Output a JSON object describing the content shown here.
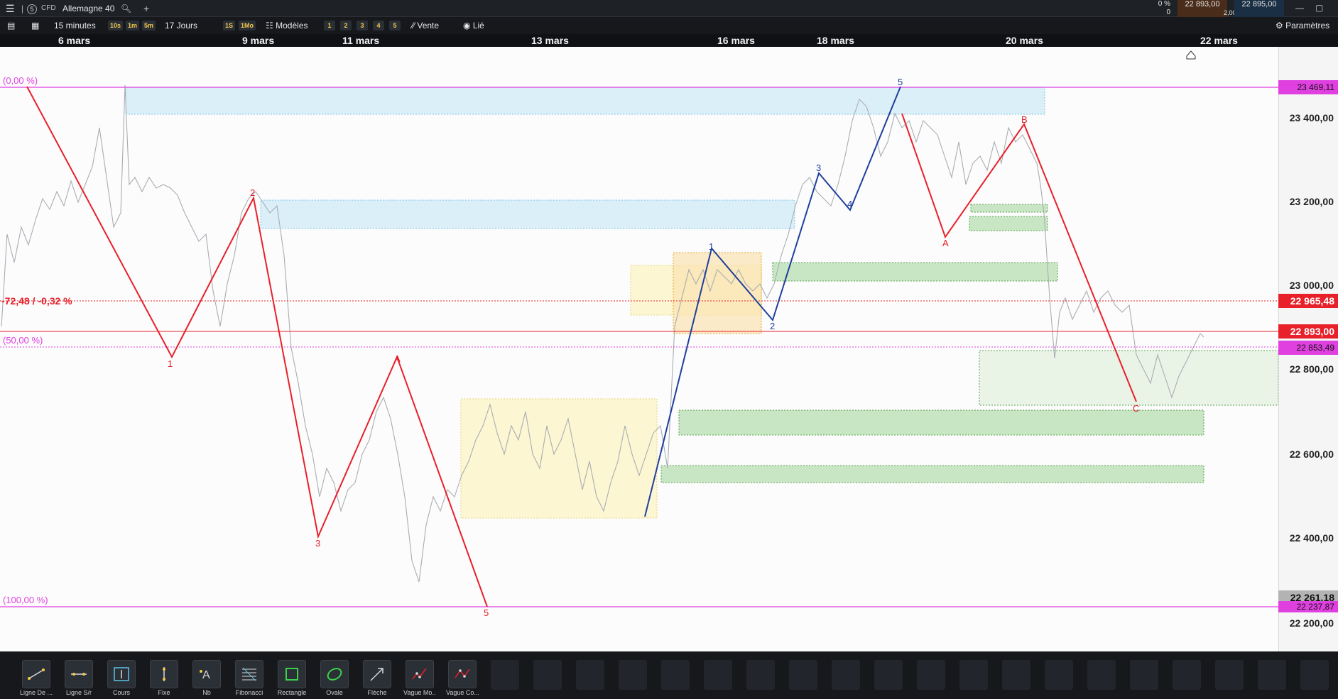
{
  "header": {
    "menu_icon": "hamburger-icon",
    "instrument_badge": "5",
    "instrument_type": "CFD",
    "instrument_name": "Allemagne 40",
    "search_icon": "search-icon",
    "add_tab": "+",
    "change_pct": "0 %",
    "change_abs": "0",
    "change_zero": "0",
    "sell_price": "22 893,00",
    "spread": "2,00",
    "buy_price": "22 895,00"
  },
  "toolbar": {
    "interval": "15 minutes",
    "int_buttons": [
      "10s",
      "1m",
      "5m"
    ],
    "range": "17 Jours",
    "range_buttons": [
      "1S",
      "1Mo"
    ],
    "templates": "Modèles",
    "template_slots": [
      "1",
      "2",
      "3",
      "4",
      "5"
    ],
    "order_side": "Vente",
    "link": "Lié",
    "settings": "Paramètres"
  },
  "dates": [
    "6 mars",
    "9 mars",
    "11 mars",
    "13 mars",
    "16 mars",
    "18 mars",
    "20 mars",
    "22 mars"
  ],
  "price_axis": [
    "23 400,00",
    "23 200,00",
    "23 000,00",
    "22 800,00",
    "22 600,00",
    "22 400,00",
    "22 200,00"
  ],
  "tags": {
    "fib_top": "23 469,11",
    "last_close_ref": "22 965,48",
    "current": "22 893,00",
    "fib_mid": "22 853,49",
    "low_ref": "22 261,18",
    "fib_bottom": "22 237,87"
  },
  "overlay": {
    "fib_0": "(0,00 %)",
    "fib_50": "(50,00 %)",
    "fib_100": "(100,00 %)",
    "change_label": "-72,48 / -0,32 %"
  },
  "wave_labels": {
    "red_impulse": [
      "1",
      "2",
      "3",
      "A",
      "5"
    ],
    "blue_impulse": [
      "1",
      "2",
      "3",
      "4",
      "5"
    ],
    "red_correction": [
      "A",
      "B",
      "C"
    ]
  },
  "tools": [
    {
      "label": "Ligne De ...",
      "icon": "trendline-icon"
    },
    {
      "label": "Ligne S/r",
      "icon": "sr-line-icon"
    },
    {
      "label": "Cours",
      "icon": "price-icon"
    },
    {
      "label": "Fixe",
      "icon": "vertical-line-icon"
    },
    {
      "label": "Nb",
      "icon": "text-icon"
    },
    {
      "label": "Fibonacci",
      "icon": "fibonacci-icon"
    },
    {
      "label": "Rectangle",
      "icon": "rectangle-icon"
    },
    {
      "label": "Ovale",
      "icon": "ellipse-icon"
    },
    {
      "label": "Flèche",
      "icon": "arrow-icon"
    },
    {
      "label": "Vague Mo...",
      "icon": "wave-icon"
    },
    {
      "label": "Vague Co...",
      "icon": "wave-correction-icon"
    }
  ],
  "colors": {
    "red_wave": "#e8202a",
    "blue_wave": "#1f3f9e",
    "fib_line": "#e040e0",
    "price_line": "#e8202a",
    "zone_blue": "#cdeaf7",
    "zone_green": "#c9e6c4",
    "zone_yellow": "#fbf4c8",
    "zone_orange": "#fbe3b0"
  }
}
